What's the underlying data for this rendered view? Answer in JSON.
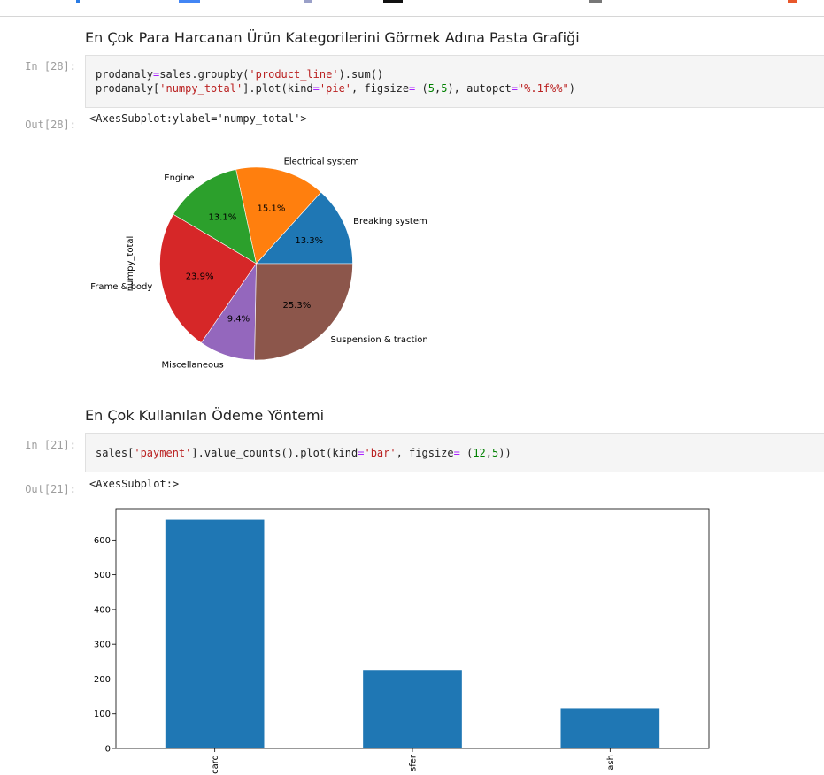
{
  "cells": {
    "heading1": "En Çok Para Harcanan Ürün Kategorilerini Görmek Adına Pasta Grafiği",
    "in28_prompt": "In [28]:",
    "out28_prompt": "Out[28]:",
    "code28_line1": [
      {
        "t": "prodanaly",
        "c": ""
      },
      {
        "t": "=",
        "c": "o"
      },
      {
        "t": "sales.groupby(",
        "c": ""
      },
      {
        "t": "'product_line'",
        "c": "s"
      },
      {
        "t": ").sum()",
        "c": ""
      }
    ],
    "code28_line2": [
      {
        "t": "prodanaly[",
        "c": ""
      },
      {
        "t": "'numpy_total'",
        "c": "s"
      },
      {
        "t": "].plot(kind",
        "c": ""
      },
      {
        "t": "=",
        "c": "o"
      },
      {
        "t": "'pie'",
        "c": "s"
      },
      {
        "t": ", figsize",
        "c": ""
      },
      {
        "t": "=",
        "c": "o"
      },
      {
        "t": " (",
        "c": ""
      },
      {
        "t": "5",
        "c": "n"
      },
      {
        "t": ",",
        "c": ""
      },
      {
        "t": "5",
        "c": "n"
      },
      {
        "t": "), autopct",
        "c": ""
      },
      {
        "t": "=",
        "c": "o"
      },
      {
        "t": "\"%.1f%%\"",
        "c": "s"
      },
      {
        "t": ")",
        "c": ""
      }
    ],
    "out28_text": "<AxesSubplot:ylabel='numpy_total'>",
    "heading2": "En Çok Kullanılan Ödeme Yöntemi",
    "in21_prompt": "In [21]:",
    "out21_prompt": "Out[21]:",
    "code21_line1": [
      {
        "t": "sales[",
        "c": ""
      },
      {
        "t": "'payment'",
        "c": "s"
      },
      {
        "t": "].value_counts().plot(kind",
        "c": ""
      },
      {
        "t": "=",
        "c": "o"
      },
      {
        "t": "'bar'",
        "c": "s"
      },
      {
        "t": ", figsize",
        "c": ""
      },
      {
        "t": "=",
        "c": "o"
      },
      {
        "t": " (",
        "c": ""
      },
      {
        "t": "12",
        "c": "n"
      },
      {
        "t": ",",
        "c": ""
      },
      {
        "t": "5",
        "c": "n"
      },
      {
        "t": "))",
        "c": ""
      }
    ],
    "out21_text": "<AxesSubplot:>"
  },
  "chart_data": [
    {
      "type": "pie",
      "ylabel": "numpy_total",
      "start_angle_deg": 0,
      "labels": [
        "Breaking system",
        "Electrical system",
        "Engine",
        "Frame & body",
        "Miscellaneous",
        "Suspension & traction"
      ],
      "values": [
        13.3,
        15.1,
        13.1,
        23.9,
        9.4,
        25.3
      ],
      "pct_labels": [
        "13.3%",
        "15.1%",
        "13.1%",
        "23.9%",
        "9.4%",
        "25.3%"
      ],
      "colors": [
        "#1f77b4",
        "#ff7f0e",
        "#2ca02c",
        "#d62728",
        "#9467bd",
        "#8c564b"
      ]
    },
    {
      "type": "bar",
      "categories": [
        "card",
        "sfer",
        "ash"
      ],
      "values": [
        658,
        226,
        116
      ],
      "ylim": [
        0,
        690
      ],
      "yticks": [
        0,
        100,
        200,
        300,
        400,
        500,
        600
      ],
      "color": "#1f77b4",
      "xlabel": "",
      "ylabel": ""
    }
  ]
}
